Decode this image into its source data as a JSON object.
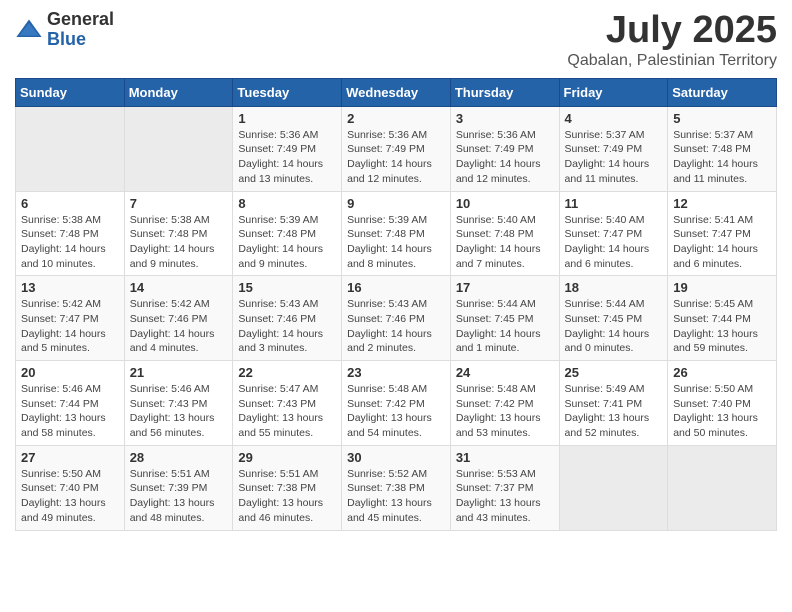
{
  "logo": {
    "general": "General",
    "blue": "Blue"
  },
  "title": "July 2025",
  "subtitle": "Qabalan, Palestinian Territory",
  "days_header": [
    "Sunday",
    "Monday",
    "Tuesday",
    "Wednesday",
    "Thursday",
    "Friday",
    "Saturday"
  ],
  "weeks": [
    [
      {
        "day": "",
        "sunrise": "",
        "sunset": "",
        "daylight": ""
      },
      {
        "day": "",
        "sunrise": "",
        "sunset": "",
        "daylight": ""
      },
      {
        "day": "1",
        "sunrise": "Sunrise: 5:36 AM",
        "sunset": "Sunset: 7:49 PM",
        "daylight": "Daylight: 14 hours and 13 minutes."
      },
      {
        "day": "2",
        "sunrise": "Sunrise: 5:36 AM",
        "sunset": "Sunset: 7:49 PM",
        "daylight": "Daylight: 14 hours and 12 minutes."
      },
      {
        "day": "3",
        "sunrise": "Sunrise: 5:36 AM",
        "sunset": "Sunset: 7:49 PM",
        "daylight": "Daylight: 14 hours and 12 minutes."
      },
      {
        "day": "4",
        "sunrise": "Sunrise: 5:37 AM",
        "sunset": "Sunset: 7:49 PM",
        "daylight": "Daylight: 14 hours and 11 minutes."
      },
      {
        "day": "5",
        "sunrise": "Sunrise: 5:37 AM",
        "sunset": "Sunset: 7:48 PM",
        "daylight": "Daylight: 14 hours and 11 minutes."
      }
    ],
    [
      {
        "day": "6",
        "sunrise": "Sunrise: 5:38 AM",
        "sunset": "Sunset: 7:48 PM",
        "daylight": "Daylight: 14 hours and 10 minutes."
      },
      {
        "day": "7",
        "sunrise": "Sunrise: 5:38 AM",
        "sunset": "Sunset: 7:48 PM",
        "daylight": "Daylight: 14 hours and 9 minutes."
      },
      {
        "day": "8",
        "sunrise": "Sunrise: 5:39 AM",
        "sunset": "Sunset: 7:48 PM",
        "daylight": "Daylight: 14 hours and 9 minutes."
      },
      {
        "day": "9",
        "sunrise": "Sunrise: 5:39 AM",
        "sunset": "Sunset: 7:48 PM",
        "daylight": "Daylight: 14 hours and 8 minutes."
      },
      {
        "day": "10",
        "sunrise": "Sunrise: 5:40 AM",
        "sunset": "Sunset: 7:48 PM",
        "daylight": "Daylight: 14 hours and 7 minutes."
      },
      {
        "day": "11",
        "sunrise": "Sunrise: 5:40 AM",
        "sunset": "Sunset: 7:47 PM",
        "daylight": "Daylight: 14 hours and 6 minutes."
      },
      {
        "day": "12",
        "sunrise": "Sunrise: 5:41 AM",
        "sunset": "Sunset: 7:47 PM",
        "daylight": "Daylight: 14 hours and 6 minutes."
      }
    ],
    [
      {
        "day": "13",
        "sunrise": "Sunrise: 5:42 AM",
        "sunset": "Sunset: 7:47 PM",
        "daylight": "Daylight: 14 hours and 5 minutes."
      },
      {
        "day": "14",
        "sunrise": "Sunrise: 5:42 AM",
        "sunset": "Sunset: 7:46 PM",
        "daylight": "Daylight: 14 hours and 4 minutes."
      },
      {
        "day": "15",
        "sunrise": "Sunrise: 5:43 AM",
        "sunset": "Sunset: 7:46 PM",
        "daylight": "Daylight: 14 hours and 3 minutes."
      },
      {
        "day": "16",
        "sunrise": "Sunrise: 5:43 AM",
        "sunset": "Sunset: 7:46 PM",
        "daylight": "Daylight: 14 hours and 2 minutes."
      },
      {
        "day": "17",
        "sunrise": "Sunrise: 5:44 AM",
        "sunset": "Sunset: 7:45 PM",
        "daylight": "Daylight: 14 hours and 1 minute."
      },
      {
        "day": "18",
        "sunrise": "Sunrise: 5:44 AM",
        "sunset": "Sunset: 7:45 PM",
        "daylight": "Daylight: 14 hours and 0 minutes."
      },
      {
        "day": "19",
        "sunrise": "Sunrise: 5:45 AM",
        "sunset": "Sunset: 7:44 PM",
        "daylight": "Daylight: 13 hours and 59 minutes."
      }
    ],
    [
      {
        "day": "20",
        "sunrise": "Sunrise: 5:46 AM",
        "sunset": "Sunset: 7:44 PM",
        "daylight": "Daylight: 13 hours and 58 minutes."
      },
      {
        "day": "21",
        "sunrise": "Sunrise: 5:46 AM",
        "sunset": "Sunset: 7:43 PM",
        "daylight": "Daylight: 13 hours and 56 minutes."
      },
      {
        "day": "22",
        "sunrise": "Sunrise: 5:47 AM",
        "sunset": "Sunset: 7:43 PM",
        "daylight": "Daylight: 13 hours and 55 minutes."
      },
      {
        "day": "23",
        "sunrise": "Sunrise: 5:48 AM",
        "sunset": "Sunset: 7:42 PM",
        "daylight": "Daylight: 13 hours and 54 minutes."
      },
      {
        "day": "24",
        "sunrise": "Sunrise: 5:48 AM",
        "sunset": "Sunset: 7:42 PM",
        "daylight": "Daylight: 13 hours and 53 minutes."
      },
      {
        "day": "25",
        "sunrise": "Sunrise: 5:49 AM",
        "sunset": "Sunset: 7:41 PM",
        "daylight": "Daylight: 13 hours and 52 minutes."
      },
      {
        "day": "26",
        "sunrise": "Sunrise: 5:50 AM",
        "sunset": "Sunset: 7:40 PM",
        "daylight": "Daylight: 13 hours and 50 minutes."
      }
    ],
    [
      {
        "day": "27",
        "sunrise": "Sunrise: 5:50 AM",
        "sunset": "Sunset: 7:40 PM",
        "daylight": "Daylight: 13 hours and 49 minutes."
      },
      {
        "day": "28",
        "sunrise": "Sunrise: 5:51 AM",
        "sunset": "Sunset: 7:39 PM",
        "daylight": "Daylight: 13 hours and 48 minutes."
      },
      {
        "day": "29",
        "sunrise": "Sunrise: 5:51 AM",
        "sunset": "Sunset: 7:38 PM",
        "daylight": "Daylight: 13 hours and 46 minutes."
      },
      {
        "day": "30",
        "sunrise": "Sunrise: 5:52 AM",
        "sunset": "Sunset: 7:38 PM",
        "daylight": "Daylight: 13 hours and 45 minutes."
      },
      {
        "day": "31",
        "sunrise": "Sunrise: 5:53 AM",
        "sunset": "Sunset: 7:37 PM",
        "daylight": "Daylight: 13 hours and 43 minutes."
      },
      {
        "day": "",
        "sunrise": "",
        "sunset": "",
        "daylight": ""
      },
      {
        "day": "",
        "sunrise": "",
        "sunset": "",
        "daylight": ""
      }
    ]
  ]
}
